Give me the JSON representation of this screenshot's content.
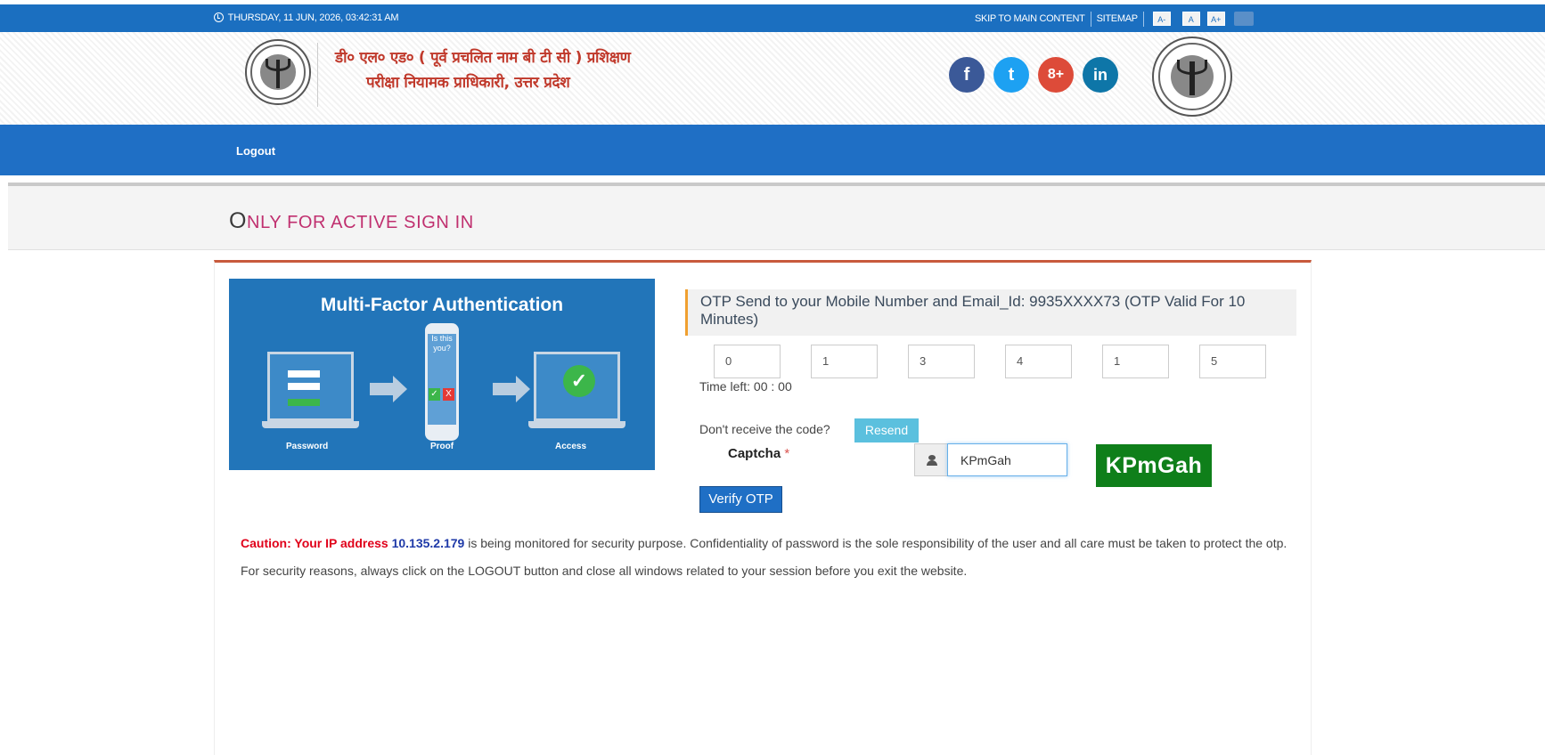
{
  "topbar": {
    "datetime": "THURSDAY, 11 JUN, 2026, 03:42:31 AM",
    "skip_link": "SKIP TO MAIN CONTENT",
    "sitemap_link": "SITEMAP",
    "font_small": "A-",
    "font_normal": "A",
    "font_large": "A+"
  },
  "header": {
    "title_line1": "डी० एल० एड० ( पूर्व प्रचलित नाम बी टी सी ) प्रशिक्षण",
    "title_line2": "परीक्षा नियामक प्राधिकारी, उत्तर प्रदेश",
    "social": {
      "facebook": "f",
      "twitter": "t",
      "googleplus": "8+",
      "linkedin": "in"
    }
  },
  "nav": {
    "logout": "Logout"
  },
  "page": {
    "heading_first": "O",
    "heading_rest": "NLY FOR ACTIVE SIGN IN"
  },
  "mfa_image": {
    "title": "Multi-Factor Authentication",
    "phone_text_line1": "Is this",
    "phone_text_line2": "you?",
    "label_password": "Password",
    "label_proof": "Proof",
    "label_access": "Access"
  },
  "otp": {
    "info": "OTP Send to your Mobile Number and Email_Id: 9935XXXX73 (OTP Valid For 10 Minutes)",
    "digits": [
      "0",
      "1",
      "3",
      "4",
      "1",
      "5"
    ],
    "time_left": "Time left: 00 : 00",
    "not_received": "Don't receive the code?",
    "resend_label": "Resend"
  },
  "captcha": {
    "label": "Captcha",
    "required_mark": "*",
    "input_value": "KPmGah",
    "image_text": "KPmGah"
  },
  "verify_label": "Verify OTP",
  "caution": {
    "prefix": "Caution: Your IP address",
    "ip": "10.135.2.179",
    "text": "is being monitored for security purpose. Confidentiality of password is the sole responsibility of the user and all care must be taken to protect the otp. For security reasons, always click on the LOGOUT button and close all windows related to your session before you exit the website."
  },
  "colors": {
    "topbar": "#1b6fc0",
    "nav": "#1f6fc5",
    "heading": "#c0306f",
    "card_border": "#c85a3c",
    "captcha_bg": "#0f7f1a",
    "resend": "#5bc0de"
  }
}
